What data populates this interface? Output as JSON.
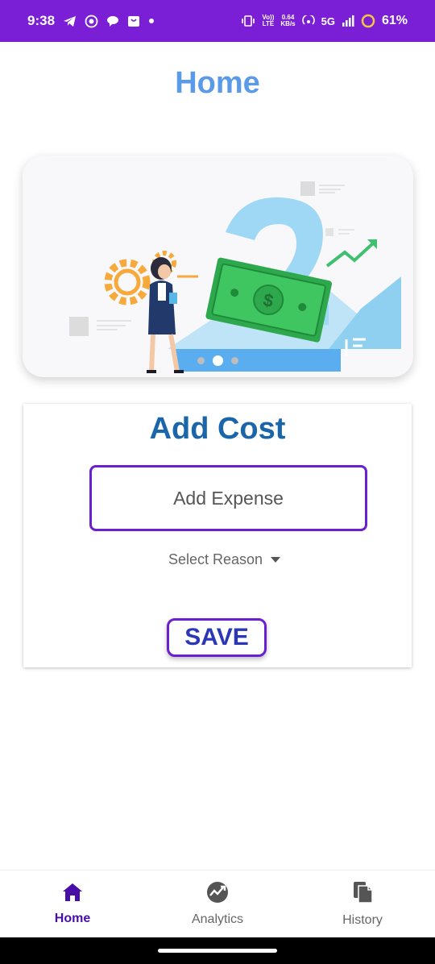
{
  "status_bar": {
    "time": "9:38",
    "lte_top": "Vo))",
    "lte_bottom": "LTE",
    "speed_top": "0.64",
    "speed_bottom": "KB/s",
    "network": "5G",
    "battery": "61%"
  },
  "header": {
    "title": "Home"
  },
  "banner": {
    "slide_count": 3,
    "active_slide": 2
  },
  "add_cost": {
    "title": "Add Cost",
    "expense_placeholder": "Add Expense",
    "reason_label": "Select Reason",
    "save_label": "SAVE"
  },
  "bottom_nav": {
    "items": [
      {
        "label": "Home",
        "icon": "home-icon",
        "active": true
      },
      {
        "label": "Analytics",
        "icon": "analytics-icon",
        "active": false
      },
      {
        "label": "History",
        "icon": "history-icon",
        "active": false
      }
    ]
  },
  "colors": {
    "status_bar": "#7b1fd6",
    "title": "#5b9ae9",
    "card_title": "#1a66a8",
    "accent_border": "#6a1fd0",
    "save_text": "#2a37b7",
    "nav_active": "#4a0ea8"
  }
}
